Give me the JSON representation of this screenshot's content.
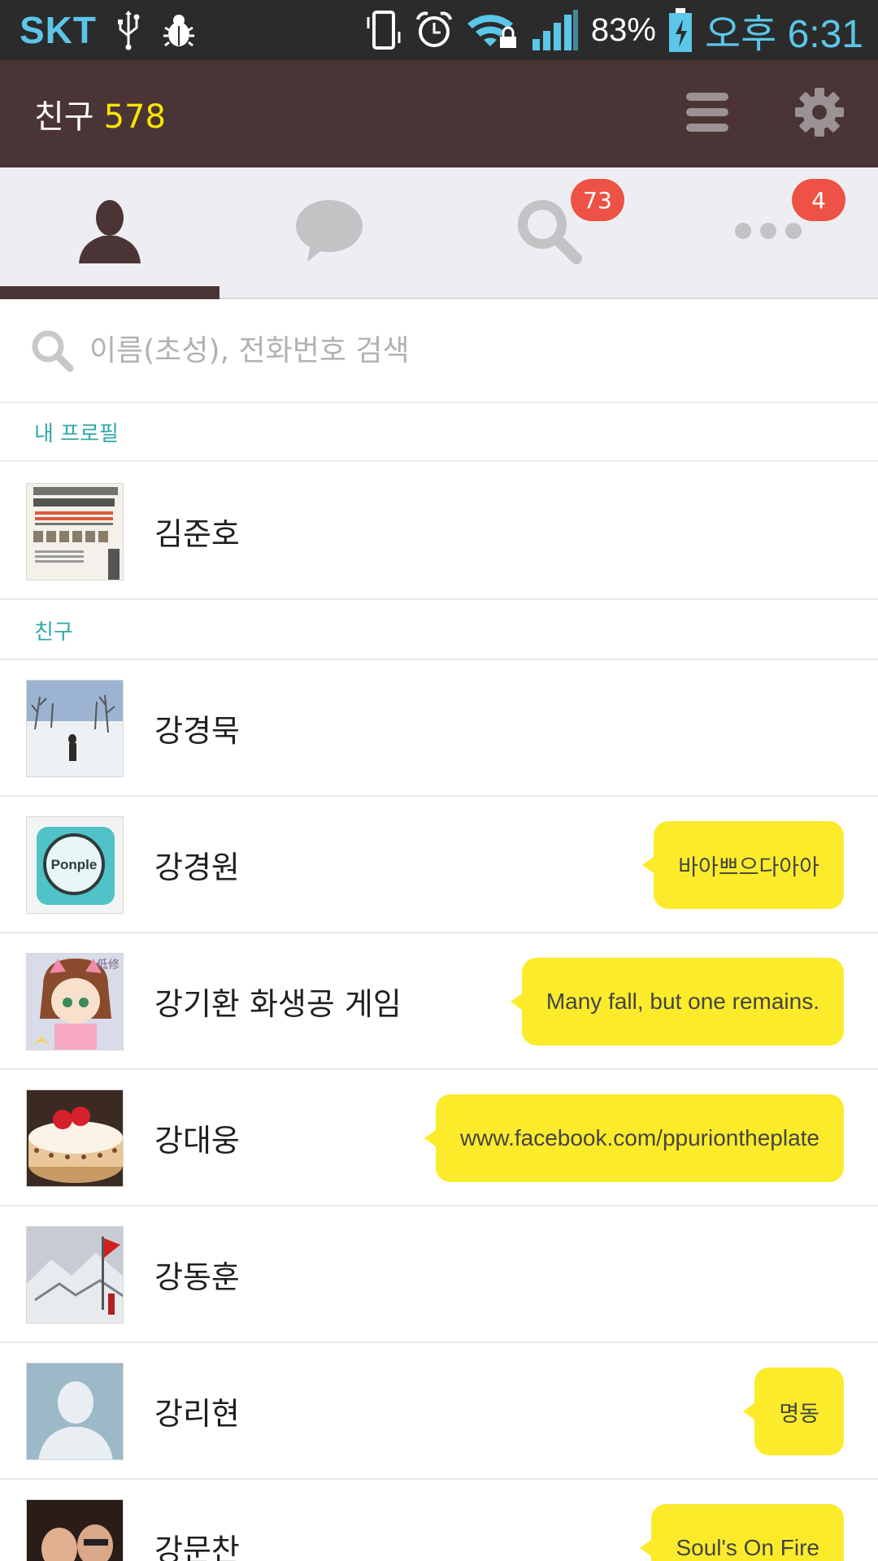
{
  "status_bar": {
    "carrier": "SKT",
    "battery": "83%",
    "time": "오후 6:31",
    "icons": [
      "usb-icon",
      "debug-icon",
      "vibrate-icon",
      "alarm-icon",
      "wifi-lock-icon",
      "signal-icon",
      "battery-charging-icon"
    ]
  },
  "header": {
    "title": "친구",
    "count": "578",
    "actions": [
      "menu-icon",
      "gear-icon"
    ]
  },
  "tabs": [
    {
      "name": "friends",
      "icon": "person-icon",
      "active": true,
      "badge": ""
    },
    {
      "name": "chats",
      "icon": "chat-bubble-icon",
      "active": false,
      "badge": ""
    },
    {
      "name": "find",
      "icon": "search-icon",
      "active": false,
      "badge": "73"
    },
    {
      "name": "more",
      "icon": "more-dots-icon",
      "active": false,
      "badge": "4"
    }
  ],
  "search": {
    "placeholder": "이름(초성), 전화번호 검색"
  },
  "sections": {
    "my_profile": "내 프로필",
    "friends": "친구"
  },
  "my_profile": {
    "name": "김준호"
  },
  "friends": [
    {
      "name": "강경묵",
      "status": ""
    },
    {
      "name": "강경원",
      "status": "바아쁘으다아아"
    },
    {
      "name": "강기환 화생공 게임",
      "status": "Many fall, but one remains."
    },
    {
      "name": "강대웅",
      "status": "www.facebook.com/ppuriontheplate"
    },
    {
      "name": "강동훈",
      "status": ""
    },
    {
      "name": "강리현",
      "status": "명동"
    },
    {
      "name": "강문찬",
      "status": "Soul's On Fire"
    }
  ],
  "colors": {
    "header_bg": "#4b3436",
    "count": "#f7e600",
    "status_bubble": "#fbeb2b",
    "section_label": "#30a8a8",
    "badge": "#ee5145"
  }
}
